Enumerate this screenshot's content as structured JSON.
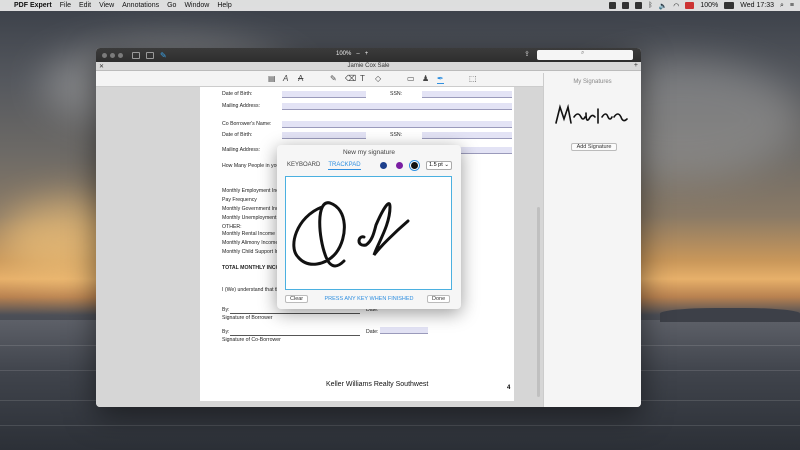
{
  "menubar": {
    "app": "PDF Expert",
    "items": [
      "File",
      "Edit",
      "View",
      "Annotations",
      "Go",
      "Window",
      "Help"
    ],
    "battery": "100%",
    "clock": "Wed 17:33"
  },
  "window": {
    "zoom": "100%",
    "zoom_minus": "–",
    "zoom_plus": "+",
    "doc_title": "Jamie Cox Sale"
  },
  "form": {
    "labels": [
      "Date of Birth:",
      "Mailing Address:",
      "Co Borrower's Name:",
      "Date of Birth:",
      "Mailing Address:",
      "How Many People in your",
      "Monthly Employment Inco",
      "Pay Frequency",
      "Monthly Government Inco",
      "Monthly Unemployment Inc",
      "OTHER:",
      "Monthly Rental Income",
      "Monthly Alimony Income",
      "Monthly Child Support Inco",
      "TOTAL MONTHLY INCOM",
      "I (We) understand that the",
      "By:",
      "Signature of Borrower",
      "By:",
      "Signature of Co-Borrower"
    ],
    "ssn_label": "SSN:",
    "date_label": "Date:",
    "footer": "Keller Williams Realty Southwest",
    "page_number": "4"
  },
  "sidepanel": {
    "title": "My Signatures",
    "signature": "Marina",
    "add_button": "Add Signature"
  },
  "dialog": {
    "title": "New my signature",
    "tabs": [
      "KEYBOARD",
      "TRACKPAD"
    ],
    "active_tab": "TRACKPAD",
    "colors": [
      "#1c3f8c",
      "#7b1fa2",
      "#111111"
    ],
    "thickness": "1.5 pt",
    "clear": "Clear",
    "hint": "PRESS ANY KEY WHEN FINISHED",
    "done": "Done"
  }
}
